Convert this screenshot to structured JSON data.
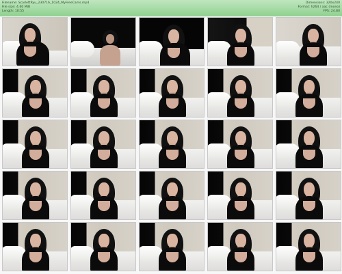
{
  "header": {
    "filename": "Filename: ScarlettRyu_230716_1024_MyFreeCams.mp4",
    "filesize": "File size: 4.60 MiB",
    "length": "Length: 10:55",
    "dimensions": "Dimensions: 320x240",
    "format": "Format: h264 / aac (mono)",
    "fps": "FPS: 24.80"
  },
  "thumbnails": [
    {
      "variant": "alt1"
    },
    {
      "variant": "alt2"
    },
    {
      "variant": "alt3"
    },
    {
      "variant": "alt4"
    },
    {
      "variant": "alt5"
    },
    {
      "variant": "base"
    },
    {
      "variant": "base"
    },
    {
      "variant": "base"
    },
    {
      "variant": "base"
    },
    {
      "variant": "base"
    },
    {
      "variant": "base"
    },
    {
      "variant": "base"
    },
    {
      "variant": "base"
    },
    {
      "variant": "base"
    },
    {
      "variant": "base"
    },
    {
      "variant": "base"
    },
    {
      "variant": "base"
    },
    {
      "variant": "base"
    },
    {
      "variant": "base"
    },
    {
      "variant": "base"
    },
    {
      "variant": "base"
    },
    {
      "variant": "base"
    },
    {
      "variant": "base"
    },
    {
      "variant": "base"
    },
    {
      "variant": "base"
    }
  ]
}
